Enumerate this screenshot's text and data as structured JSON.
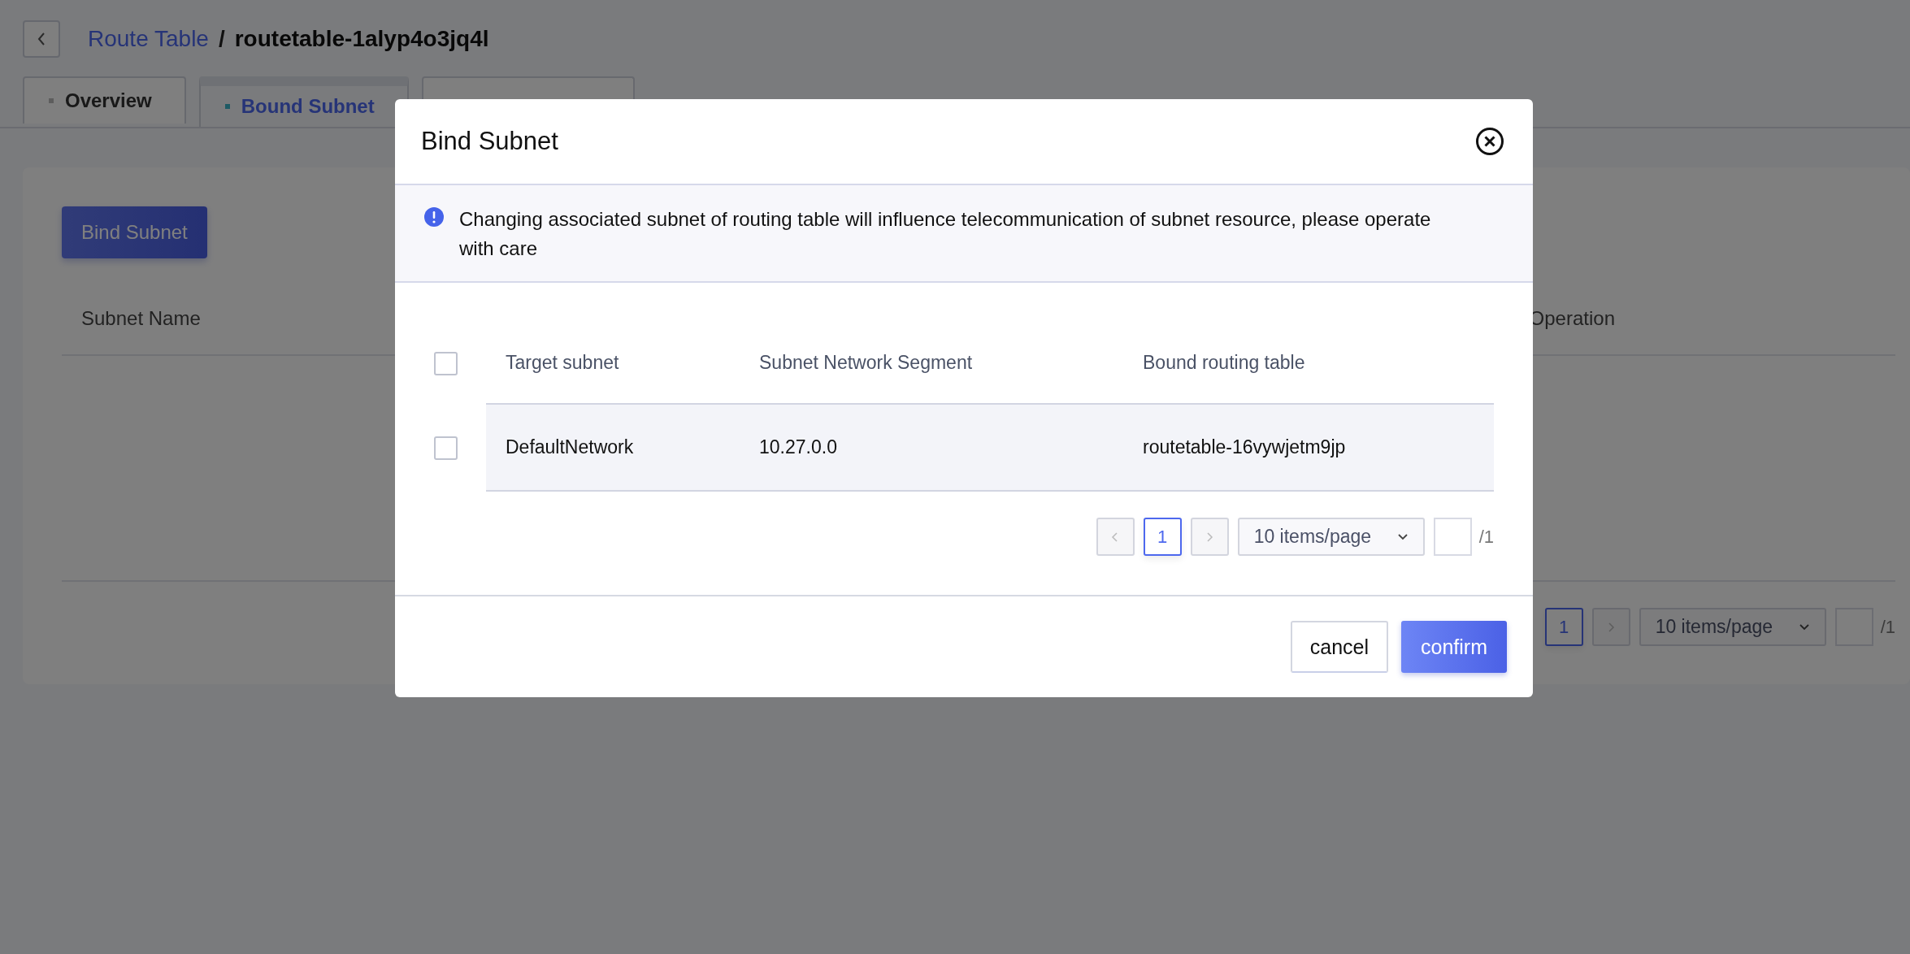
{
  "breadcrumb": {
    "parent": "Route Table",
    "separator": "/",
    "current": "routetable-1alyp4o3jq4l"
  },
  "tabs": [
    {
      "label": "Overview",
      "selected": false
    },
    {
      "label": "Bound Subnet",
      "selected": true
    },
    {
      "selected": false
    }
  ],
  "bind_button": "Bind Subnet",
  "table": {
    "columns": [
      "Subnet Name",
      "Operation"
    ]
  },
  "pagination": {
    "page": "1",
    "page_size": "10 items/page",
    "total": "/1"
  },
  "dialog": {
    "title": "Bind Subnet",
    "notice": "Changing associated subnet of routing table will influence telecommunication of subnet resource, please operate with care",
    "table": {
      "all_checked": false,
      "columns": [
        "Target subnet",
        "Subnet Network Segment",
        "Bound routing table"
      ],
      "rows": [
        {
          "checked": false,
          "cells": [
            "DefaultNetwork",
            "10.27.0.0",
            "routetable-16vywjetm9jp"
          ]
        }
      ]
    },
    "pagination": {
      "page": "1",
      "page_size": "10 items/page",
      "total": "/1"
    },
    "buttons": [
      {
        "label": "cancel",
        "kind": "secondary"
      },
      {
        "label": "confirm",
        "kind": "primary"
      }
    ]
  }
}
